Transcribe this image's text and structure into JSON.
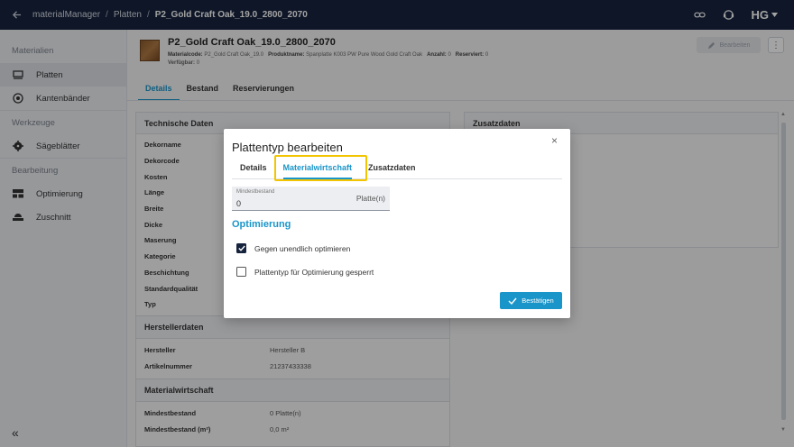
{
  "topbar": {
    "breadcrumbs": [
      "materialManager",
      "Platten",
      "P2_Gold Craft Oak_19.0_2800_2070"
    ],
    "brand": "HG"
  },
  "sidebar": {
    "groups": [
      {
        "label": "Materialien",
        "items": [
          {
            "label": "Platten",
            "icon": "board-icon",
            "active": true
          },
          {
            "label": "Kantenbänder",
            "icon": "edge-band-icon",
            "active": false
          }
        ]
      },
      {
        "label": "Werkzeuge",
        "items": [
          {
            "label": "Sägeblätter",
            "icon": "saw-blade-icon",
            "active": false
          }
        ]
      },
      {
        "label": "Bearbeitung",
        "items": [
          {
            "label": "Optimierung",
            "icon": "optimization-icon",
            "active": false
          },
          {
            "label": "Zuschnitt",
            "icon": "cutting-icon",
            "active": false
          }
        ]
      }
    ],
    "collapse_label": "«"
  },
  "header": {
    "title": "P2_Gold Craft Oak_19.0_2800_2070",
    "meta": [
      {
        "key": "Materialcode:",
        "value": "P2_Gold Craft Oak_19.0"
      },
      {
        "key": "Produktname:",
        "value": "Spanplatte K003 PW Pure Wood Gold Craft Oak"
      },
      {
        "key": "Anzahl:",
        "value": "0"
      },
      {
        "key": "Reserviert:",
        "value": "0"
      }
    ],
    "available": {
      "key": "Verfügbar:",
      "value": "0"
    },
    "edit_label": "Bearbeiten",
    "more_label": "⋮"
  },
  "tabs": [
    {
      "label": "Details",
      "active": true
    },
    {
      "label": "Bestand",
      "active": false
    },
    {
      "label": "Reservierungen",
      "active": false
    }
  ],
  "technical": {
    "title": "Technische Daten",
    "rows": [
      {
        "key": "Dekorname",
        "value": ""
      },
      {
        "key": "Dekorcode",
        "value": ""
      },
      {
        "key": "Kosten",
        "value": ""
      },
      {
        "key": "Länge",
        "value": ""
      },
      {
        "key": "Breite",
        "value": ""
      },
      {
        "key": "Dicke",
        "value": ""
      },
      {
        "key": "Maserung",
        "value": ""
      },
      {
        "key": "Kategorie",
        "value": ""
      },
      {
        "key": "Beschichtung",
        "value": ""
      },
      {
        "key": "Standardqualität",
        "value": ""
      },
      {
        "key": "Typ",
        "value": ""
      }
    ]
  },
  "manufacturer": {
    "title": "Herstellerdaten",
    "rows": [
      {
        "key": "Hersteller",
        "value": "Hersteller B"
      },
      {
        "key": "Artikelnummer",
        "value": "21237433338"
      }
    ]
  },
  "material_mgmt": {
    "title": "Materialwirtschaft",
    "rows": [
      {
        "key": "Mindestbestand",
        "value": "0 Platte(n)"
      },
      {
        "key": "Mindestbestand (m²)",
        "value": "0,0 m²"
      }
    ]
  },
  "additional": {
    "title": "Zusatzdaten"
  },
  "dialog": {
    "title": "Plattentyp bearbeiten",
    "close": "×",
    "tabs": [
      {
        "label": "Details",
        "active": false
      },
      {
        "label": "Materialwirtschaft",
        "active": true
      },
      {
        "label": "Zusatzdaten",
        "active": false
      }
    ],
    "min_stock": {
      "label": "Mindestbestand",
      "value": "0",
      "unit": "Platte(n)"
    },
    "optimization": {
      "title": "Optimierung",
      "options": [
        {
          "label": "Gegen unendlich optimieren",
          "checked": true
        },
        {
          "label": "Plattentyp für Optimierung gesperrt",
          "checked": false
        }
      ]
    },
    "confirm_label": "Bestätigen"
  },
  "colors": {
    "accent": "#1a95c9",
    "topbar": "#16233d",
    "highlight": "#f2c500"
  }
}
